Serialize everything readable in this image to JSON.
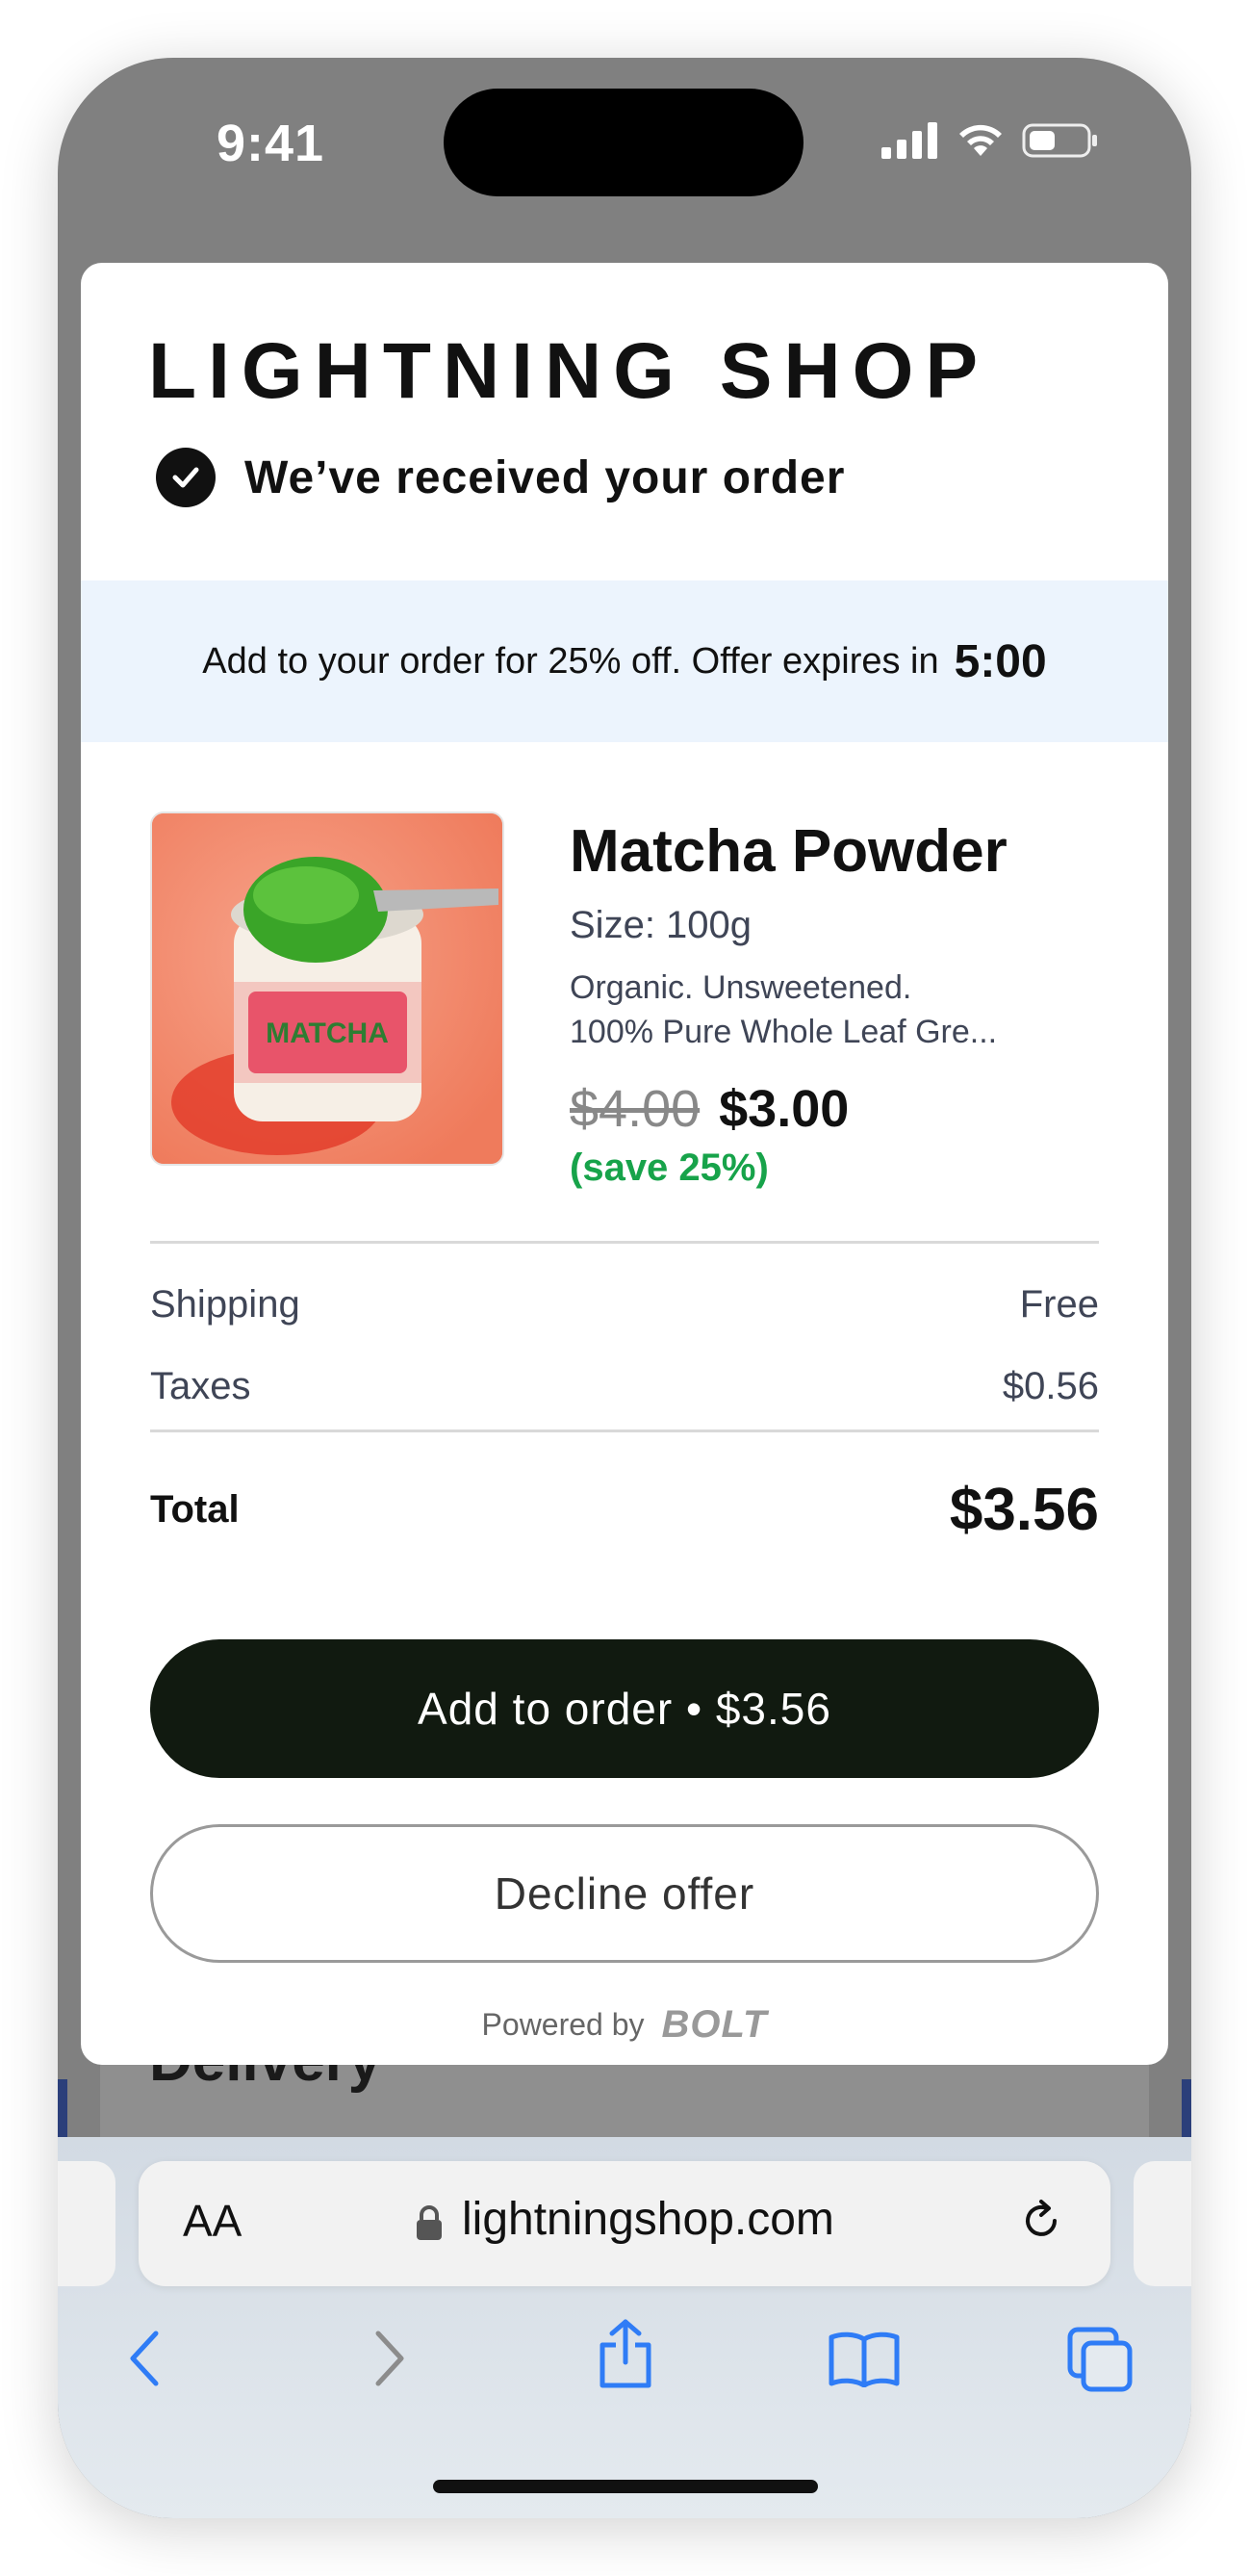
{
  "status_bar": {
    "time": "9:41"
  },
  "background_page": {
    "section_title": "Delivery"
  },
  "modal": {
    "brand": "LIGHTNING SHOP",
    "confirmation": "We’ve received your order",
    "offer_banner": {
      "text": "Add to your order for 25% off. Offer expires in",
      "timer": "5:00"
    },
    "product": {
      "name": "Matcha Powder",
      "size": "Size: 100g",
      "description_line1": "Organic. Unsweetened.",
      "description_line2": "100% Pure Whole Leaf Gre...",
      "old_price": "$4.00",
      "new_price": "$3.00",
      "savings": "(save 25%)",
      "image_jar_label": "MATCHA"
    },
    "summary": {
      "shipping_label": "Shipping",
      "shipping_value": "Free",
      "taxes_label": "Taxes",
      "taxes_value": "$0.56",
      "total_label": "Total",
      "total_value": "$3.56"
    },
    "add_button": "Add to order • $3.56",
    "decline_button": "Decline offer",
    "powered_by": "Powered by",
    "powered_brand": "BOLT"
  },
  "browser": {
    "aa": "AA",
    "url": "lightningshop.com",
    "toolbar": [
      "back-icon",
      "forward-icon",
      "share-icon",
      "bookmarks-icon",
      "tabs-icon"
    ]
  },
  "colors": {
    "accent_button": "#111a10",
    "savings_green": "#17a34a",
    "banner_bg": "#ecf4fd",
    "safari_blue": "#2f7cf6"
  }
}
